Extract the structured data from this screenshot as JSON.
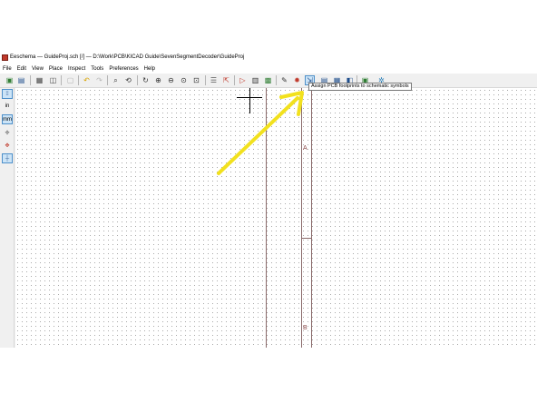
{
  "window": {
    "title": "Eeschema — GuideProj.sch [/] — D:\\Work\\PCB\\KICAD Guide\\SevenSegmentDecoder\\GuideProj"
  },
  "menubar": {
    "items": [
      "File",
      "Edit",
      "View",
      "Place",
      "Inspect",
      "Tools",
      "Preferences",
      "Help"
    ]
  },
  "toolbar": {
    "tooltip": "Assign PCB footprints to schematic symbols",
    "icons": [
      "save-icon",
      "print-icon",
      "plot-icon",
      "paste-icon",
      "undo-icon",
      "redo-icon",
      "find-icon",
      "find-replace-icon",
      "refresh-icon",
      "zoom-in-icon",
      "zoom-out-icon",
      "zoom-fit-icon",
      "zoom-selection-icon",
      "hierarchy-navigator-icon",
      "leave-sheet-icon",
      "library-editor-icon",
      "library-browser-icon",
      "footprint-editor-icon",
      "annotate-icon",
      "erc-icon",
      "assign-footprints-icon",
      "bom-icon",
      "netlist-icon",
      "pcbnew-icon",
      "python-icon"
    ]
  },
  "lefttoolbar": {
    "unit_in": "in",
    "unit_mm": "mm"
  },
  "canvas": {
    "sheet_row_a": "A",
    "sheet_row_b": "B"
  },
  "colors": {
    "annotation_arrow": "#f2e11e",
    "sheet_border": "#8a6a6a",
    "selection": "#cce4f7"
  }
}
